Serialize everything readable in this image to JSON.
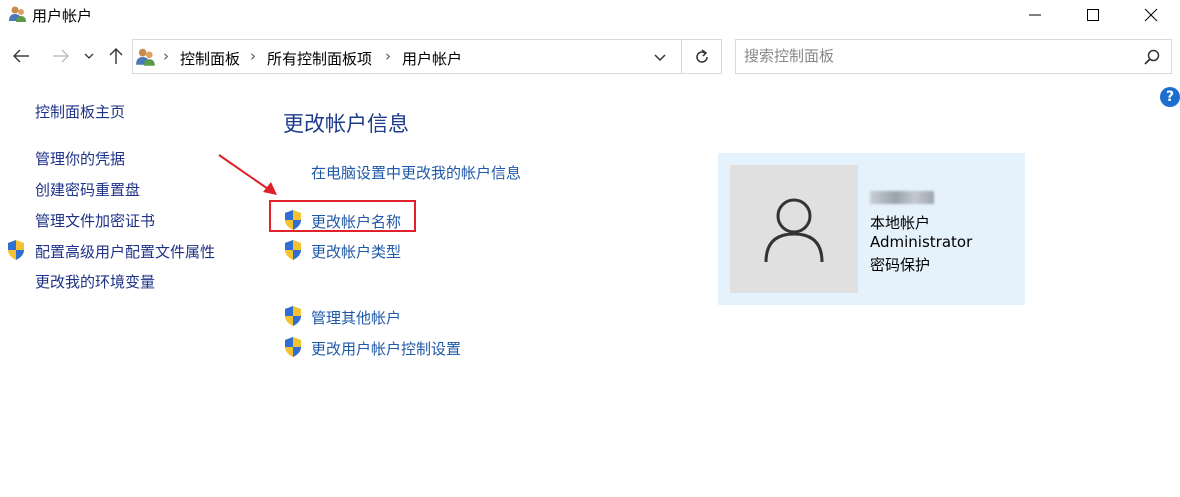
{
  "window": {
    "title": "用户帐户"
  },
  "nav": {
    "breadcrumb": [
      "控制面板",
      "所有控制面板项",
      "用户帐户"
    ],
    "search_placeholder": "搜索控制面板"
  },
  "sidebar": {
    "items": [
      {
        "label": "控制面板主页",
        "shield": false
      },
      {
        "label": "管理你的凭据",
        "shield": false
      },
      {
        "label": "创建密码重置盘",
        "shield": false
      },
      {
        "label": "管理文件加密证书",
        "shield": false
      },
      {
        "label": "配置高级用户配置文件属性",
        "shield": true
      },
      {
        "label": "更改我的环境变量",
        "shield": false
      }
    ]
  },
  "main": {
    "heading": "更改帐户信息",
    "links": [
      {
        "label": "在电脑设置中更改我的帐户信息",
        "shield": false
      },
      {
        "label": "更改帐户名称",
        "shield": true,
        "highlighted": true
      },
      {
        "label": "更改帐户类型",
        "shield": true
      },
      {
        "label": "管理其他帐户",
        "shield": true
      },
      {
        "label": "更改用户帐户控制设置",
        "shield": true
      }
    ]
  },
  "account": {
    "type": "本地帐户",
    "group": "Administrator",
    "protection": "密码保护"
  },
  "colors": {
    "link": "#1f59a8",
    "sidebar_link": "#1e3287",
    "heading": "#1e3c8c",
    "card_bg": "#e5f1fb",
    "highlight": "#e0202a",
    "help": "#1b6fd1"
  }
}
